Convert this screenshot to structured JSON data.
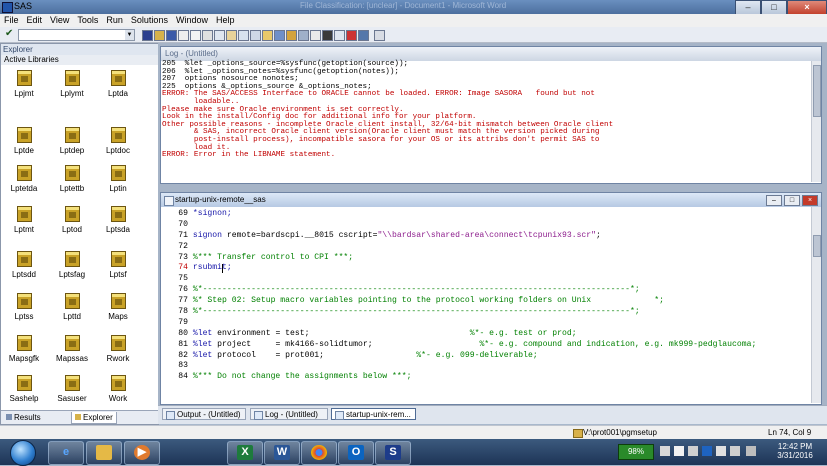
{
  "window": {
    "title": "SAS",
    "background_title": "File Classification: [unclear] - Document1 - Microsoft Word",
    "controls": [
      "minimize",
      "maximize",
      "close"
    ]
  },
  "menu": [
    "File",
    "Edit",
    "View",
    "Tools",
    "Run",
    "Solutions",
    "Window",
    "Help"
  ],
  "toolbar": {
    "command_value": "",
    "check_icon": "checkmark-icon"
  },
  "explorer": {
    "title": "Explorer",
    "subtitle": "Active Libraries",
    "libraries": [
      "Lpjmt",
      "Lplymt",
      "Lptda",
      "Lptde",
      "Lptdep",
      "Lptdoc",
      "Lptetda",
      "Lptettb",
      "Lptin",
      "Lptmt",
      "Lptod",
      "Lptsda",
      "Lptsdd",
      "Lptsfag",
      "Lptsf",
      "Lptss",
      "Lpttd",
      "Maps",
      "Mapsgfk",
      "Mapssas",
      "Rwork",
      "Sashelp",
      "Sasuser",
      "Work"
    ],
    "tabs": [
      "Results",
      "Explorer"
    ]
  },
  "log": {
    "title": "Log - (Untitled)",
    "lines": [
      {
        "text": "205  %let _options_source=%sysfunc(getoption(source));",
        "color": "black"
      },
      {
        "text": "206  %let _options_notes=%sysfunc(getoption(notes));",
        "color": "black"
      },
      {
        "text": "207  options nosource nonotes;",
        "color": "black"
      },
      {
        "text": "225  options &_options_source &_options_notes;",
        "color": "black"
      },
      {
        "text": "ERROR: The SAS/ACCESS Interface to ORACLE cannot be loaded. ERROR: Image SASORA   found but not",
        "color": "red"
      },
      {
        "text": "       loadable..",
        "color": "red"
      },
      {
        "text": "Please make sure Oracle environment is set correctly.",
        "color": "red"
      },
      {
        "text": "Look in the install/Config doc for additional info for your platform.",
        "color": "red"
      },
      {
        "text": "Other possible reasons - incomplete Oracle client install, 32/64-bit mismatch between Oracle client",
        "color": "red"
      },
      {
        "text": "       & SAS, incorrect Oracle client version(Oracle client must match the version picked during",
        "color": "red"
      },
      {
        "text": "       post-install process), incompatible sasora for your OS or its attribs don't permit SAS to",
        "color": "red"
      },
      {
        "text": "       load it.",
        "color": "red"
      },
      {
        "text": "ERROR: Error in the LIBNAME statement.",
        "color": "red"
      }
    ]
  },
  "editor": {
    "title": "startup-unix-remote__sas",
    "lines": [
      {
        "num": "69",
        "tokens": [
          {
            "t": "*signon;",
            "c": "k"
          }
        ]
      },
      {
        "num": "70",
        "tokens": []
      },
      {
        "num": "71",
        "tokens": [
          {
            "t": "signon ",
            "c": "k"
          },
          {
            "t": "remote=bardscpi.__8015 cscript=",
            "c": "t"
          },
          {
            "t": "\"\\\\bardsar\\shared-area\\connect\\tcpunix93.scr\"",
            "c": "s"
          },
          {
            "t": ";",
            "c": "t"
          }
        ]
      },
      {
        "num": "72",
        "tokens": []
      },
      {
        "num": "73",
        "tokens": [
          {
            "t": "%*** Transfer control to CPI ***;",
            "c": "c"
          }
        ]
      },
      {
        "num": "74",
        "red": true,
        "tokens": [
          {
            "t": "rsubmit;",
            "c": "k"
          }
        ]
      },
      {
        "num": "75",
        "tokens": []
      },
      {
        "num": "76",
        "tokens": [
          {
            "t": "%*----------------------------------------------------------------------------------------*;",
            "c": "c"
          }
        ]
      },
      {
        "num": "77",
        "tokens": [
          {
            "t": "%* Step 02: Setup macro variables pointing to the protocol working folders on Unix             *;",
            "c": "c"
          }
        ]
      },
      {
        "num": "78",
        "tokens": [
          {
            "t": "%*----------------------------------------------------------------------------------------*;",
            "c": "c"
          }
        ]
      },
      {
        "num": "79",
        "tokens": []
      },
      {
        "num": "80",
        "tokens": [
          {
            "t": "%let",
            "c": "k"
          },
          {
            "t": " environment = test;",
            "c": "t"
          },
          {
            "t": "                                 %*- e.g. test or prod;",
            "c": "c"
          }
        ]
      },
      {
        "num": "81",
        "tokens": [
          {
            "t": "%let",
            "c": "k"
          },
          {
            "t": " project     = mk4166-solidtumor;",
            "c": "t"
          },
          {
            "t": "                      %*- e.g. compound and indication, e.g. mk999-pedglaucoma;",
            "c": "c"
          }
        ]
      },
      {
        "num": "82",
        "tokens": [
          {
            "t": "%let",
            "c": "k"
          },
          {
            "t": " protocol    = prot001;",
            "c": "t"
          },
          {
            "t": "                   %*- e.g. 099-deliverable;",
            "c": "c"
          }
        ]
      },
      {
        "num": "83",
        "tokens": []
      },
      {
        "num": "84",
        "tokens": [
          {
            "t": "%*** Do not change the assignments below ***;",
            "c": "c"
          }
        ]
      }
    ]
  },
  "window_tabs": [
    "Output - (Untitled)",
    "Log - (Untitled)",
    "startup-unix-rem..."
  ],
  "status": {
    "path": "V:\\prot001\\pgmsetup",
    "position": "Ln 74, Col 9"
  },
  "taskbar": {
    "battery": "98%",
    "time": "12:42 PM",
    "date": "3/31/2016",
    "apps": [
      "internet-explorer-icon",
      "file-explorer-icon",
      "media-player-icon",
      "excel-icon",
      "word-icon",
      "chrome-icon",
      "outlook-icon",
      "sas-icon"
    ]
  }
}
